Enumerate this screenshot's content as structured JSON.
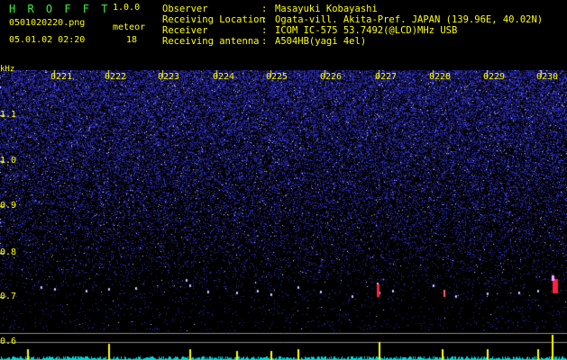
{
  "header": {
    "app_name": "H R O F F T",
    "version": "1.0.0",
    "filename": "0501020220.png",
    "datetime": "05.01.02 02:20",
    "meteor_label": "meteor",
    "meteor_count": "18"
  },
  "info": [
    {
      "key": "Observer",
      "value": "Masayuki Kobayashi"
    },
    {
      "key": "Receiving Location",
      "value": "Ogata-vill. Akita-Pref. JAPAN (139.96E, 40.02N)"
    },
    {
      "key": "Receiver",
      "value": "ICOM IC-575 53.7492(@LCD)MHz USB"
    },
    {
      "key": "Receiving antenna",
      "value": "A504HB(yagi 4el)"
    }
  ],
  "spectrogram": {
    "y_unit": "kHz",
    "y_ticks": [
      "1.1",
      "1.0",
      "0.9",
      "0.8",
      "0.7",
      "0.6"
    ],
    "time_ticks": [
      "0221",
      "0222",
      "0223",
      "0224",
      "0225",
      "0226",
      "0227",
      "0228",
      "0229",
      "0230"
    ],
    "colors": {
      "background": "#000000",
      "noise": "#1a1aa8",
      "text": "#ffff00",
      "histogram": "#00e0e0"
    }
  }
}
